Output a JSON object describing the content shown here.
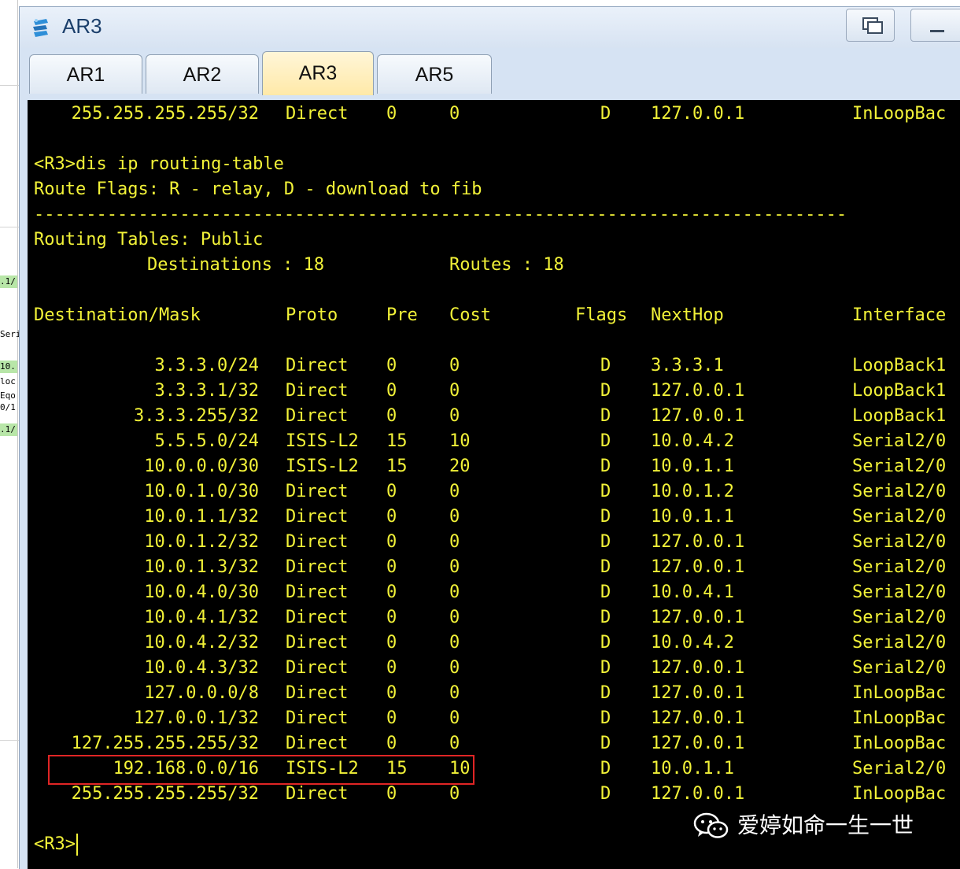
{
  "window": {
    "title": "AR3",
    "tabs": [
      {
        "label": "AR1",
        "active": false
      },
      {
        "label": "AR2",
        "active": false
      },
      {
        "label": "AR3",
        "active": true
      },
      {
        "label": "AR5",
        "active": false
      }
    ]
  },
  "background": {
    "fragments": [
      ".1/",
      "Seri",
      "10.",
      "loc",
      "Eqo",
      "0/1",
      ".1/"
    ]
  },
  "terminal": {
    "top_row": {
      "dest": "255.255.255.255/32",
      "proto": "Direct",
      "pre": "0",
      "cost": "0",
      "flags": "D",
      "nexthop": "127.0.0.1",
      "iface": "InLoopBac"
    },
    "command": "<R3>dis ip routing-table",
    "flags_legend": "Route Flags: R - relay, D - download to fib",
    "separator": "------------------------------------------------------------------------------",
    "tables_title": "Routing Tables: Public",
    "destinations_label": "Destinations : 18",
    "routes_label": "Routes : 18",
    "header": {
      "dest": "Destination/Mask",
      "proto": "Proto",
      "pre": "Pre",
      "cost": "Cost",
      "flags": "Flags",
      "nexthop": "NextHop",
      "iface": "Interface"
    },
    "rows": [
      {
        "dest": "3.3.3.0/24",
        "proto": "Direct",
        "pre": "0",
        "cost": "0",
        "flags": "D",
        "nexthop": "3.3.3.1",
        "iface": "LoopBack1"
      },
      {
        "dest": "3.3.3.1/32",
        "proto": "Direct",
        "pre": "0",
        "cost": "0",
        "flags": "D",
        "nexthop": "127.0.0.1",
        "iface": "LoopBack1"
      },
      {
        "dest": "3.3.3.255/32",
        "proto": "Direct",
        "pre": "0",
        "cost": "0",
        "flags": "D",
        "nexthop": "127.0.0.1",
        "iface": "LoopBack1"
      },
      {
        "dest": "5.5.5.0/24",
        "proto": "ISIS-L2",
        "pre": "15",
        "cost": "10",
        "flags": "D",
        "nexthop": "10.0.4.2",
        "iface": "Serial2/0"
      },
      {
        "dest": "10.0.0.0/30",
        "proto": "ISIS-L2",
        "pre": "15",
        "cost": "20",
        "flags": "D",
        "nexthop": "10.0.1.1",
        "iface": "Serial2/0"
      },
      {
        "dest": "10.0.1.0/30",
        "proto": "Direct",
        "pre": "0",
        "cost": "0",
        "flags": "D",
        "nexthop": "10.0.1.2",
        "iface": "Serial2/0"
      },
      {
        "dest": "10.0.1.1/32",
        "proto": "Direct",
        "pre": "0",
        "cost": "0",
        "flags": "D",
        "nexthop": "10.0.1.1",
        "iface": "Serial2/0"
      },
      {
        "dest": "10.0.1.2/32",
        "proto": "Direct",
        "pre": "0",
        "cost": "0",
        "flags": "D",
        "nexthop": "127.0.0.1",
        "iface": "Serial2/0"
      },
      {
        "dest": "10.0.1.3/32",
        "proto": "Direct",
        "pre": "0",
        "cost": "0",
        "flags": "D",
        "nexthop": "127.0.0.1",
        "iface": "Serial2/0"
      },
      {
        "dest": "10.0.4.0/30",
        "proto": "Direct",
        "pre": "0",
        "cost": "0",
        "flags": "D",
        "nexthop": "10.0.4.1",
        "iface": "Serial2/0"
      },
      {
        "dest": "10.0.4.1/32",
        "proto": "Direct",
        "pre": "0",
        "cost": "0",
        "flags": "D",
        "nexthop": "127.0.0.1",
        "iface": "Serial2/0"
      },
      {
        "dest": "10.0.4.2/32",
        "proto": "Direct",
        "pre": "0",
        "cost": "0",
        "flags": "D",
        "nexthop": "10.0.4.2",
        "iface": "Serial2/0"
      },
      {
        "dest": "10.0.4.3/32",
        "proto": "Direct",
        "pre": "0",
        "cost": "0",
        "flags": "D",
        "nexthop": "127.0.0.1",
        "iface": "Serial2/0"
      },
      {
        "dest": "127.0.0.0/8",
        "proto": "Direct",
        "pre": "0",
        "cost": "0",
        "flags": "D",
        "nexthop": "127.0.0.1",
        "iface": "InLoopBac"
      },
      {
        "dest": "127.0.0.1/32",
        "proto": "Direct",
        "pre": "0",
        "cost": "0",
        "flags": "D",
        "nexthop": "127.0.0.1",
        "iface": "InLoopBac"
      },
      {
        "dest": "127.255.255.255/32",
        "proto": "Direct",
        "pre": "0",
        "cost": "0",
        "flags": "D",
        "nexthop": "127.0.0.1",
        "iface": "InLoopBac"
      },
      {
        "dest": "192.168.0.0/16",
        "proto": "ISIS-L2",
        "pre": "15",
        "cost": "10",
        "flags": "D",
        "nexthop": "10.0.1.1",
        "iface": "Serial2/0"
      },
      {
        "dest": "255.255.255.255/32",
        "proto": "Direct",
        "pre": "0",
        "cost": "0",
        "flags": "D",
        "nexthop": "127.0.0.1",
        "iface": "InLoopBac"
      }
    ],
    "prompt": "<R3>"
  },
  "watermark": {
    "text": "爱婷如命一生一世"
  }
}
